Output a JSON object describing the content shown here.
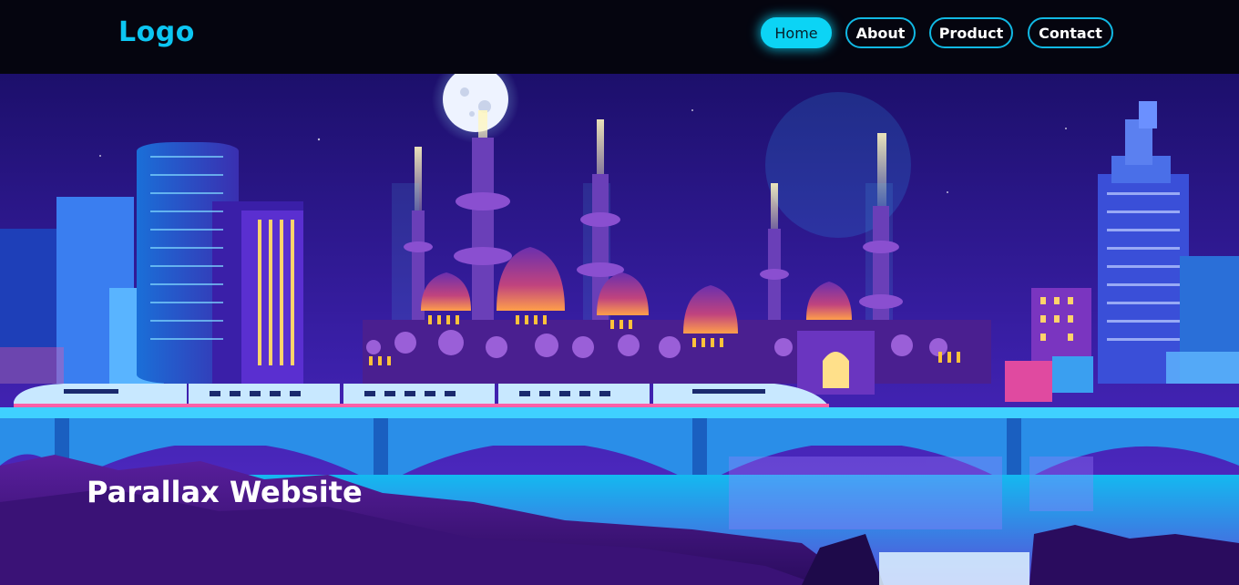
{
  "header": {
    "logo": "Logo",
    "nav": [
      {
        "label": "Home",
        "active": true
      },
      {
        "label": "About",
        "active": false
      },
      {
        "label": "Product",
        "active": false
      },
      {
        "label": "Contact",
        "active": false
      }
    ]
  },
  "hero": {
    "heading": "Parallax Website"
  },
  "colors": {
    "accent": "#0cd4f5",
    "header_bg": "#05050f",
    "sky": "#2a1a8c"
  }
}
